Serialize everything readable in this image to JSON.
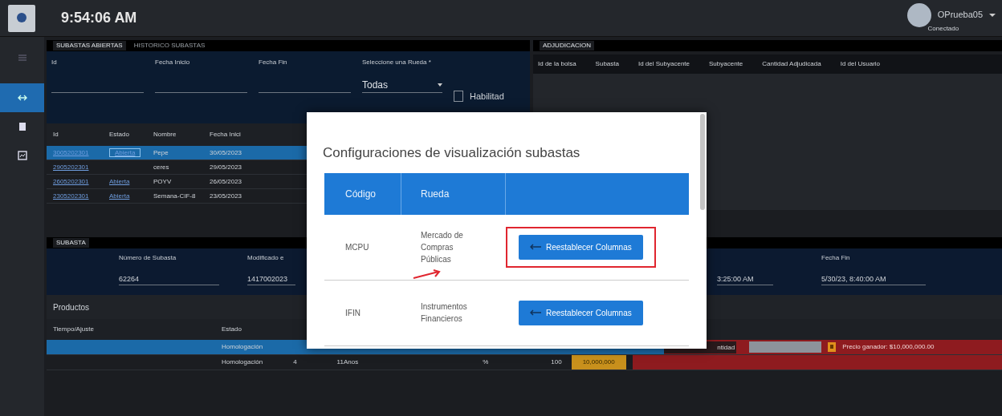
{
  "header": {
    "clock": "9:54:06 AM",
    "user": "OPrueba05",
    "status": "Conectado"
  },
  "sidebar": {
    "items": [
      {
        "kind": "menu",
        "selected": false
      },
      {
        "kind": "arrows",
        "selected": true
      },
      {
        "kind": "card",
        "selected": false
      },
      {
        "kind": "chart",
        "selected": false
      }
    ]
  },
  "left_panel": {
    "tabs": [
      {
        "label": "SUBASTAS ABIERTAS",
        "selected": true
      },
      {
        "label": "HISTORICO SUBASTAS",
        "selected": false
      }
    ],
    "filters": [
      {
        "kind": "text",
        "label": "Id"
      },
      {
        "kind": "text",
        "label": "Fecha Inicio"
      },
      {
        "kind": "text",
        "label": "Fecha Fin"
      },
      {
        "kind": "select",
        "label": "Seleccione una Rueda *",
        "value": "Todas"
      },
      {
        "kind": "checkbox",
        "label": "Habilitad",
        "checked": false
      }
    ],
    "table": {
      "columns": [
        "Id",
        "Estado",
        "Nombre",
        "Fecha Inici"
      ],
      "rows": [
        {
          "selected": true,
          "cells": [
            "3005202301",
            "Abierta",
            "Pepe",
            "30/05/2023"
          ]
        },
        {
          "selected": false,
          "cells": [
            "2905202301",
            "",
            "ceres",
            "29/05/2023"
          ]
        },
        {
          "selected": false,
          "cells": [
            "2605202301",
            "Abierta",
            "POYV",
            "26/05/2023"
          ]
        },
        {
          "selected": false,
          "cells": [
            "2305202301",
            "Abierta",
            "Semana-CIF-8",
            "23/05/2023"
          ]
        }
      ]
    }
  },
  "right_panel": {
    "tab": "ADJUDICACION",
    "columns": [
      "Id de la bolsa",
      "Subasta",
      "Id del Subyacente",
      "Subyacente",
      "Cantidad Adjudicada",
      "Id del Usuario"
    ]
  },
  "bottom_panel": {
    "tab": "SUBASTA",
    "fields_left": [
      {
        "label": "Número de Subasta",
        "value": "62264"
      },
      {
        "label": "Modificado e",
        "value": "1417002023"
      }
    ],
    "fields_right": [
      {
        "value": "3:25:00 AM"
      },
      {
        "label": "Fecha Fin",
        "value": "5/30/23, 8:40:00 AM"
      }
    ],
    "products_title": "Productos",
    "columns": [
      "Tiempo/Ajuste",
      "Estado"
    ],
    "rows": [
      {
        "selected": true,
        "status": "Homologación",
        "quantity_placeholder": "ntidad",
        "notice": "Precio ganador: $10,000,000.00"
      },
      {
        "selected": false,
        "status": "Homologación",
        "cells": [
          "4",
          "11",
          "Anos",
          "%",
          "100"
        ],
        "amount": "10,000,000"
      }
    ]
  },
  "modal": {
    "title": "Configuraciones de visualización subastas",
    "columns": [
      "Código",
      "Rueda"
    ],
    "rows": [
      {
        "code": "MCPU",
        "name": "Mercado de Compras Públicas",
        "button": "Reestablecer Columnas",
        "highlighted": true
      },
      {
        "code": "IFIN",
        "name": "Instrumentos Financieros",
        "button": "Reestablecer Columnas",
        "highlighted": false
      }
    ]
  }
}
